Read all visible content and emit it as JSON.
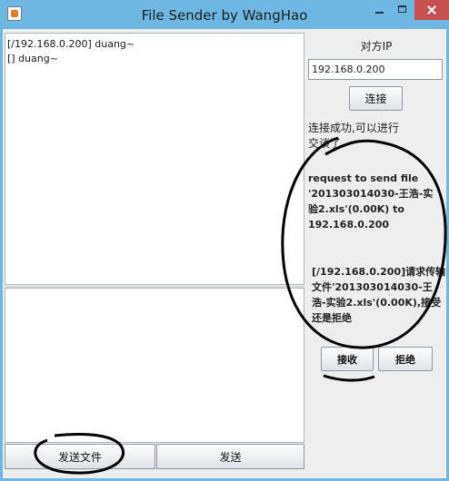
{
  "window": {
    "title": "File Sender by WangHao"
  },
  "history": {
    "lines": [
      "[/192.168.0.200] duang~",
      "[] duang~"
    ]
  },
  "buttons": {
    "send_file": "发送文件",
    "send": "发送"
  },
  "peer": {
    "label": "对方IP",
    "ip": "192.168.0.200",
    "connect": "连接"
  },
  "status": {
    "connected": "连接成功,可以进行交谈了",
    "request": "request to send file '201303014030-王浩-实验2.xls'(0.00K) to 192.168.0.200",
    "incoming": "[/192.168.0.200]请求传输文件'201303014030-王浩-实验2.xls'(0.00K),接受还是拒绝"
  },
  "actions": {
    "accept": "接收",
    "reject": "拒绝"
  }
}
